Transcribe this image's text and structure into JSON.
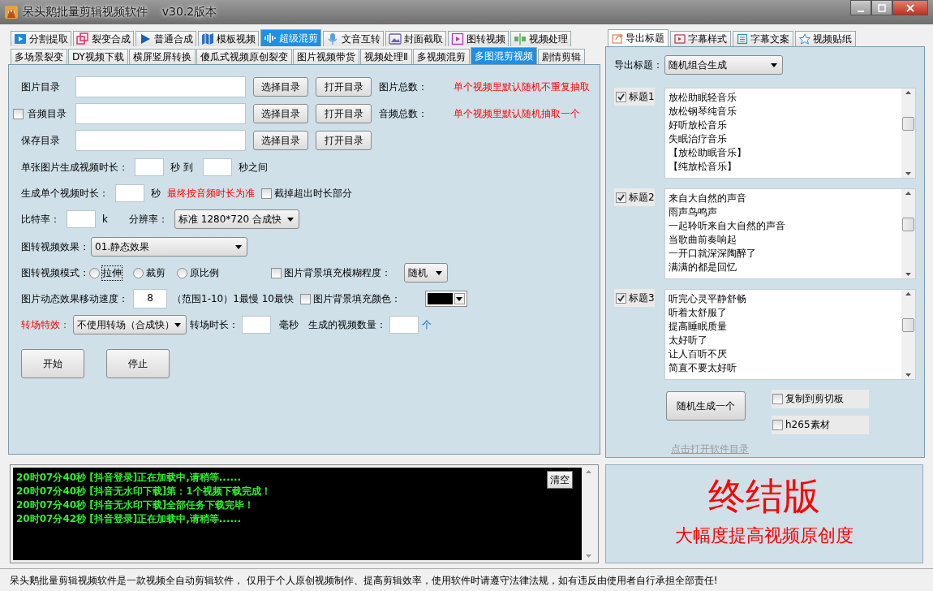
{
  "window": {
    "title": "呆头鹅批量剪辑视频软件    v30.2版本"
  },
  "main_tabs": [
    {
      "label": "分割提取",
      "selected": false
    },
    {
      "label": "裂变合成",
      "selected": false
    },
    {
      "label": "普通合成",
      "selected": false
    },
    {
      "label": "模板视频",
      "selected": false
    },
    {
      "label": "超级混剪",
      "selected": true
    },
    {
      "label": "文音互转",
      "selected": false
    },
    {
      "label": "封面截取",
      "selected": false
    },
    {
      "label": "图转视频",
      "selected": false
    },
    {
      "label": "视频处理",
      "selected": false
    }
  ],
  "sub_tabs": [
    {
      "label": "多场景裂变",
      "selected": false
    },
    {
      "label": "DY视频下载",
      "selected": false
    },
    {
      "label": "横屏竖屏转换",
      "selected": false
    },
    {
      "label": "傻瓜式视频原创裂变",
      "selected": false
    },
    {
      "label": "图片视频带货",
      "selected": false
    },
    {
      "label": "视频处理Ⅱ",
      "selected": false
    },
    {
      "label": "多视频混剪",
      "selected": false
    },
    {
      "label": "多图混剪视频",
      "selected": true
    },
    {
      "label": "剧情剪辑",
      "selected": false
    }
  ],
  "form": {
    "rows": [
      {
        "items": [
          {
            "kind": "label",
            "text": "图片目录"
          },
          {
            "kind": "input"
          },
          {
            "kind": "button",
            "text": "选择目录"
          },
          {
            "kind": "button",
            "text": "打开目录"
          },
          {
            "kind": "label",
            "text": "图片总数："
          },
          {
            "kind": "note",
            "text": "单个视频里默认随机不重复抽取"
          }
        ]
      },
      {
        "items": [
          {
            "kind": "checkbox",
            "text": "音频目录",
            "checked": false
          },
          {
            "kind": "input"
          },
          {
            "kind": "button",
            "text": "选择目录"
          },
          {
            "kind": "button",
            "text": "打开目录"
          },
          {
            "kind": "label",
            "text": "音频总数："
          },
          {
            "kind": "note",
            "text": "单个视频里默认随机抽取一个"
          }
        ]
      },
      {
        "items": [
          {
            "kind": "label",
            "text": "保存目录"
          },
          {
            "kind": "input"
          },
          {
            "kind": "button",
            "text": "选择目录"
          },
          {
            "kind": "button",
            "text": "打开目录"
          }
        ]
      },
      {
        "items": [
          {
            "kind": "label",
            "text": "单张图片生成视频时长："
          },
          {
            "kind": "input"
          },
          {
            "kind": "label",
            "text": "秒 到"
          },
          {
            "kind": "input"
          },
          {
            "kind": "label",
            "text": "秒之间"
          }
        ]
      },
      {
        "items": [
          {
            "kind": "label",
            "text": "生成单个视频时长："
          },
          {
            "kind": "input"
          },
          {
            "kind": "label",
            "text": "秒"
          },
          {
            "kind": "note",
            "text": "最终按音频时长为准"
          },
          {
            "kind": "checkbox",
            "text": "截掉超出时长部分",
            "checked": false
          }
        ]
      },
      {
        "items": [
          {
            "kind": "label",
            "text": "比特率："
          },
          {
            "kind": "input"
          },
          {
            "kind": "label",
            "text": "k"
          },
          {
            "kind": "label",
            "text": "分辨率："
          },
          {
            "kind": "select",
            "value": "标准 1280*720 合成快"
          }
        ]
      },
      {
        "items": [
          {
            "kind": "label",
            "text": "图转视频效果："
          },
          {
            "kind": "select",
            "value": "01.静态效果"
          }
        ]
      },
      {
        "items": [
          {
            "kind": "label",
            "text": "图转视频模式："
          },
          {
            "kind": "radio",
            "text": "拉伸",
            "selected": false,
            "focused": true
          },
          {
            "kind": "radio",
            "text": "裁剪",
            "selected": false,
            "focused": false
          },
          {
            "kind": "radio",
            "text": "原比例",
            "selected": false,
            "focused": false
          },
          {
            "kind": "checkbox",
            "text": "图片背景填充模糊程度：",
            "checked": false
          },
          {
            "kind": "select",
            "value": "随机"
          }
        ]
      },
      {
        "items": [
          {
            "kind": "label",
            "text": "图片动态效果移动速度："
          },
          {
            "kind": "input",
            "value": "8"
          },
          {
            "kind": "label",
            "text": "（范围1-10）1最慢 10最快"
          },
          {
            "kind": "checkbox",
            "text": "图片背景填充颜色：",
            "checked": false
          },
          {
            "kind": "color_select",
            "color": "#000000"
          }
        ]
      },
      {
        "items": [
          {
            "kind": "note",
            "text": "转场特效："
          },
          {
            "kind": "select",
            "value": "不使用转场（合成快）"
          },
          {
            "kind": "label",
            "text": "转场时长："
          },
          {
            "kind": "input"
          },
          {
            "kind": "label",
            "text": "毫秒"
          },
          {
            "kind": "label",
            "text": "生成的视频数量："
          },
          {
            "kind": "input"
          },
          {
            "kind": "accent",
            "text": "个"
          }
        ]
      },
      {
        "items": [
          {
            "kind": "big_button",
            "text": "开始"
          },
          {
            "kind": "big_button",
            "text": "停止"
          }
        ]
      }
    ]
  },
  "right_tabs": [
    {
      "label": "导出标题",
      "selected": true
    },
    {
      "label": "字幕样式",
      "selected": false
    },
    {
      "label": "字幕文案",
      "selected": false
    },
    {
      "label": "视频贴纸",
      "selected": false
    }
  ],
  "export": {
    "label": "导出标题：",
    "value": "随机组合生成"
  },
  "title_groups": [
    {
      "label": "标题1",
      "checked": true,
      "lines": [
        "放松助眠轻音乐",
        "放松钢琴纯音乐",
        "好听放松音乐",
        "失眠治疗音乐",
        "【放松助眠音乐】",
        "【纯放松音乐】"
      ]
    },
    {
      "label": "标题2",
      "checked": true,
      "lines": [
        "来自大自然的声音",
        "雨声鸟鸣声",
        "一起聆听来自大自然的声音",
        "当歌曲前奏响起",
        "一开口就深深陶醉了",
        "满满的都是回忆"
      ]
    },
    {
      "label": "标题3",
      "checked": true,
      "lines": [
        "听完心灵平静舒畅",
        "听着太舒服了",
        "提高睡眠质量",
        "太好听了",
        "让人百听不厌",
        "简直不要太好听"
      ]
    }
  ],
  "generate_button": "随机生成一个",
  "options": [
    {
      "label": "复制到剪切板",
      "checked": false
    },
    {
      "label": "h265素材",
      "checked": false
    }
  ],
  "link": "点击打开软件目录",
  "log": {
    "lines": [
      "20时07分40秒 [抖音登录]正在加载中,请稍等......",
      "20时07分40秒 [抖音无水印下载]第：1个视频下载完成！",
      "20时07分40秒 [抖音无水印下载]全部任务下载完毕！",
      "20时07分42秒 [抖音登录]正在加载中,请稍等......"
    ],
    "clear_button": "清空"
  },
  "promo": {
    "headline": "终结版",
    "subline": "大幅度提高视频原创度"
  },
  "status_bar": "呆头鹅批量剪辑视频软件是一款视频全自动剪辑软件， 仅用于个人原创视频制作、提高剪辑效率，使用软件时请遵守法律法规，如有违反由使用者自行承担全部责任!"
}
